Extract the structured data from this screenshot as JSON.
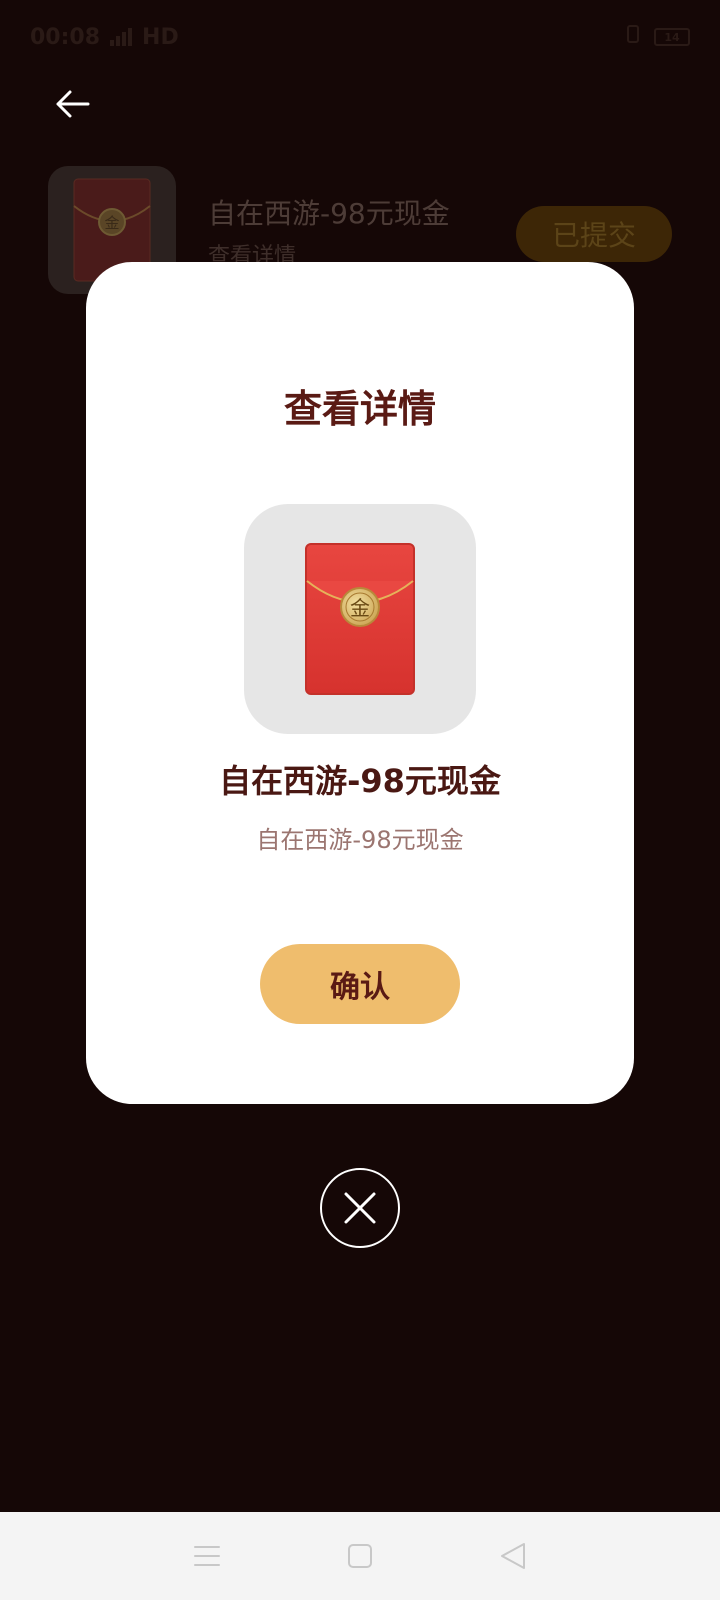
{
  "status_bar": {
    "time": "00:08",
    "network": "HD",
    "battery": "14"
  },
  "reward_item": {
    "title": "自在西游-98元现金",
    "subtitle": "查看详情",
    "status_button": "已提交",
    "badge_char": "金"
  },
  "modal": {
    "title": "查看详情",
    "badge_char": "金",
    "item_name": "自在西游-98元现金",
    "item_desc": "自在西游-98元现金",
    "confirm_label": "确认"
  },
  "icons": {
    "back": "back-arrow-icon",
    "close": "close-icon",
    "nav_menu": "menu-icon",
    "nav_home": "home-square-icon",
    "nav_back": "back-triangle-icon"
  },
  "colors": {
    "backdrop": "#150706",
    "title": "#5a1a14",
    "confirm": "#efbd6d",
    "envelope": "#e13a35"
  }
}
